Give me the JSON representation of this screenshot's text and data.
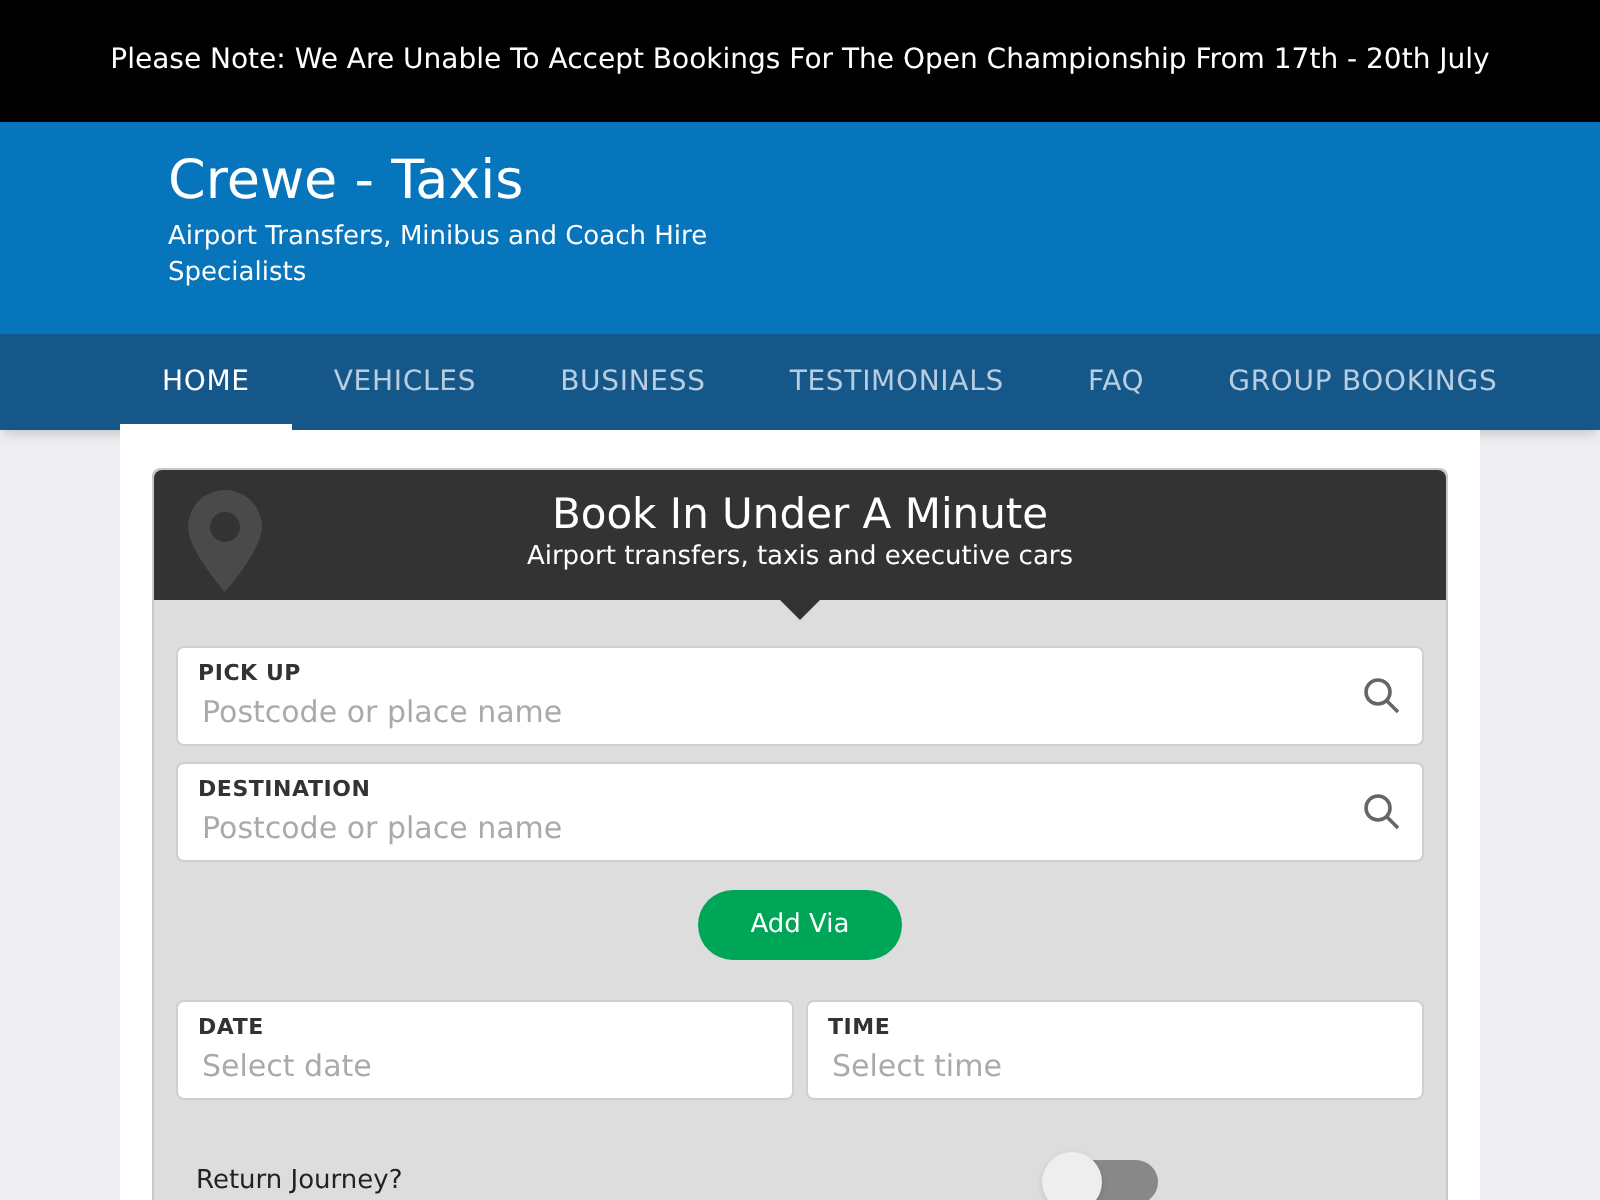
{
  "notice": "Please Note: We Are Unable To Accept Bookings For The Open Championship From 17th - 20th July",
  "header": {
    "title": "Crewe - Taxis",
    "tagline": "Airport Transfers, Minibus and Coach Hire Specialists"
  },
  "nav": [
    {
      "label": "HOME",
      "selected": true
    },
    {
      "label": "VEHICLES",
      "selected": false
    },
    {
      "label": "BUSINESS",
      "selected": false
    },
    {
      "label": "TESTIMONIALS",
      "selected": false
    },
    {
      "label": "FAQ",
      "selected": false
    },
    {
      "label": "GROUP BOOKINGS",
      "selected": false
    }
  ],
  "booking": {
    "title": "Book In Under A Minute",
    "subtitle": "Airport transfers, taxis and executive cars",
    "locations": [
      {
        "label": "PICK UP",
        "placeholder": "Postcode or place name"
      },
      {
        "label": "DESTINATION",
        "placeholder": "Postcode or place name"
      }
    ],
    "add_via": "Add Via",
    "when": [
      {
        "label": "DATE",
        "placeholder": "Select date"
      },
      {
        "label": "TIME",
        "placeholder": "Select time"
      }
    ],
    "return_journey": {
      "label": "Return Journey?",
      "on": false
    }
  }
}
